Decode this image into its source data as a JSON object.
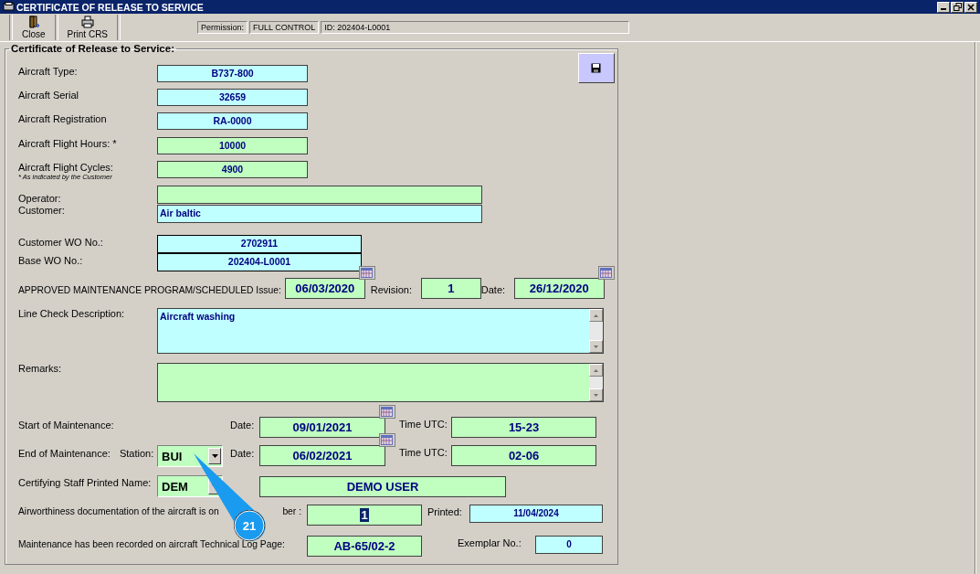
{
  "window": {
    "title": "CERTIFICATE OF RELEASE TO SERVICE"
  },
  "toolbar": {
    "buttons": [
      {
        "label": "Close",
        "kind": "door"
      },
      {
        "label": "Print CRS",
        "kind": "printer"
      }
    ],
    "permission_label": "Permission:",
    "permission": "FULL CONTROL",
    "id": "ID: 202404-L0001"
  },
  "form": {
    "legend": "Certificate of Release to Service:",
    "aircraft": [
      {
        "label": "Aircraft Type:",
        "value": "B737-800",
        "color": "#c0ffff"
      },
      {
        "label": "Aircraft Serial",
        "value": "32659",
        "color": "#c0ffff"
      },
      {
        "label": "Aircraft Registration",
        "value": "RA-0000",
        "color": "#c0ffff"
      },
      {
        "label": "Aircraft Flight Hours: *",
        "value": "10000",
        "color": "#c0ffc0"
      },
      {
        "label": "Aircraft Flight Cycles:",
        "value": "4900",
        "color": "#c0ffc0",
        "note": "* As indicated by the Customer"
      }
    ],
    "operator": {
      "label": "Operator:"
    },
    "customer": {
      "label": "Customer:",
      "value": "Air baltic"
    },
    "work_orders": [
      {
        "label": "Customer WO No.:",
        "value": "2702911"
      },
      {
        "label": "Base WO No.:",
        "value": "202404-L0001"
      }
    ],
    "program": {
      "label": "APPROVED MAINTENANCE PROGRAM/SCHEDULED Issue:",
      "issue": "06/03/2020",
      "revision_label": "Revision:",
      "revision": "1",
      "date_label": "Date:",
      "date": "26/12/2020"
    },
    "line_check": {
      "label": "Line Check Description:",
      "value": "Aircraft washing"
    },
    "remarks": {
      "label": "Remarks:"
    },
    "start": {
      "label": "Start of Maintenance:",
      "date_label": "Date:",
      "date": "09/01/2021",
      "time_label": "Time UTC:",
      "time": "15-23"
    },
    "end": {
      "label": "End of Maintenance:",
      "station_label": "Station:",
      "station": "BUI",
      "date_label": "Date:",
      "date": "06/02/2021",
      "time_label": "Time UTC:",
      "time": "02-06"
    },
    "certifying": {
      "label": "Certifying Staff Printed Name:",
      "code": "DEM",
      "name": "DEMO USER"
    },
    "airworthiness": {
      "label_start": "Airworthiness documentation of the aircraft is on",
      "label_end": "ber :",
      "value": "1",
      "printed_label": "Printed:",
      "printed": "11/04/2024"
    },
    "log_page": {
      "label": "Maintenance has been recorded on aircraft Technical Log Page:",
      "value": "AB-65/02-2",
      "exemplar_label": "Exemplar No.:",
      "exemplar": "0"
    }
  },
  "callout": {
    "number": "21"
  }
}
